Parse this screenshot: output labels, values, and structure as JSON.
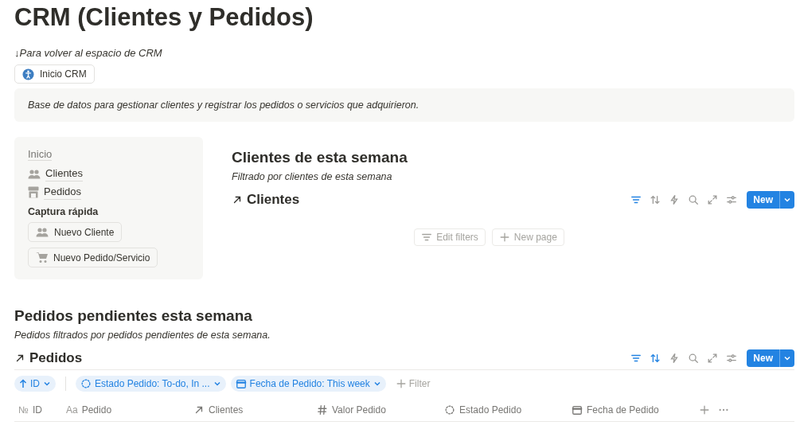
{
  "title": "CRM (Clientes y Pedidos)",
  "back_note": "↓Para volver al espacio de CRM",
  "home_button": {
    "label": "Inicio CRM"
  },
  "callout": "Base de datos para gestionar clientes y registrar los pedidos o servicios que adquirieron.",
  "nav_panel": {
    "heading": "Inicio",
    "links": [
      {
        "label": "Clientes",
        "kind": "people"
      },
      {
        "label": "Pedidos",
        "kind": "store"
      }
    ],
    "quick_heading": "Captura rápida",
    "quick_buttons": [
      {
        "label": "Nuevo Cliente",
        "kind": "people"
      },
      {
        "label": "Nuevo Pedido/Servicio",
        "kind": "cart"
      }
    ]
  },
  "clients_section": {
    "heading": "Clientes de esta semana",
    "subtitle": "Filtrado por clientes de esta semana",
    "database": "Clientes",
    "toolbar": [
      {
        "kind": "filter",
        "active": true
      },
      {
        "kind": "sort",
        "active": false
      },
      {
        "kind": "automation",
        "active": false
      },
      {
        "kind": "search",
        "active": false
      },
      {
        "kind": "expand",
        "active": false
      },
      {
        "kind": "settings",
        "active": false
      }
    ],
    "new_button": "New",
    "empty_actions": [
      {
        "label": "Edit filters",
        "kind": "filter"
      },
      {
        "label": "New page",
        "kind": "plus"
      }
    ]
  },
  "orders_section": {
    "heading": "Pedidos pendientes esta semana",
    "subtitle": "Pedidos filtrados por pedidos pendientes de esta semana.",
    "database": "Pedidos",
    "toolbar": [
      {
        "kind": "filter",
        "active": true
      },
      {
        "kind": "sort",
        "active": true
      },
      {
        "kind": "automation",
        "active": false
      },
      {
        "kind": "search",
        "active": false
      },
      {
        "kind": "expand",
        "active": false
      },
      {
        "kind": "settings",
        "active": false
      }
    ],
    "new_button": "New",
    "filters": [
      {
        "label": "ID",
        "kind": "sort"
      },
      {
        "label": "Estado Pedido: To-do, In ...",
        "kind": "status"
      },
      {
        "label": "Fecha de Pedido: This week",
        "kind": "date"
      }
    ],
    "add_filter": "Filter",
    "columns": [
      {
        "label": "ID",
        "glyph": "№"
      },
      {
        "label": "Pedido",
        "glyph": "Aa"
      },
      {
        "label": "Clientes",
        "kind": "relation"
      },
      {
        "label": "Valor Pedido",
        "kind": "money"
      },
      {
        "label": "Estado Pedido",
        "kind": "status"
      },
      {
        "label": "Fecha de Pedido",
        "kind": "date"
      }
    ],
    "column_actions": [
      {
        "kind": "add"
      },
      {
        "kind": "more"
      }
    ]
  }
}
